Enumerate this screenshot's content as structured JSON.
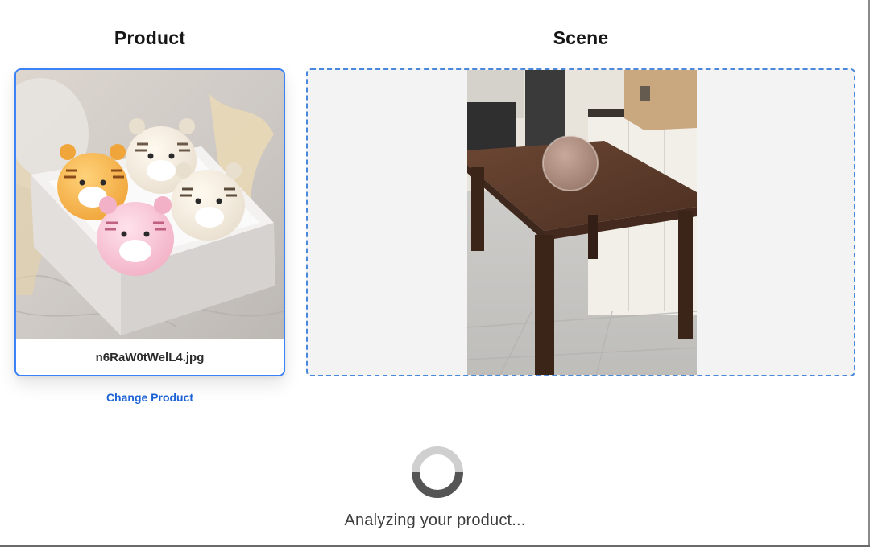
{
  "columns": {
    "product_title": "Product",
    "scene_title": "Scene"
  },
  "product": {
    "file_name": "n6RaW0tWelL4.jpg",
    "change_label": "Change Product",
    "image": "product-photo-tiger-plush-box"
  },
  "scene": {
    "image": "scene-photo-wooden-table-kitchen"
  },
  "status": {
    "message": "Analyzing your product..."
  },
  "colors": {
    "accent": "#3b82f6",
    "link": "#1d63d6",
    "scene_bg": "#f3f3f3"
  }
}
